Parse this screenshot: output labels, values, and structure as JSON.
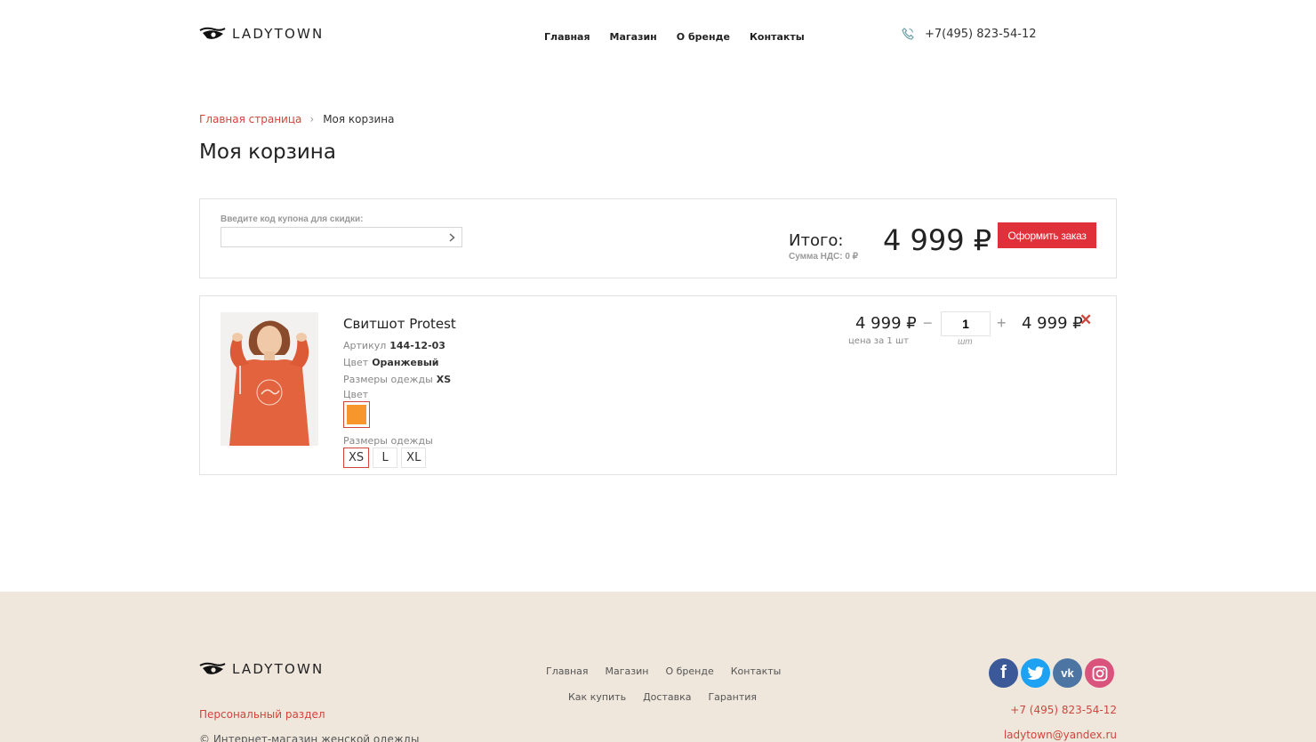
{
  "brand": {
    "name": "LADYTOWN"
  },
  "header": {
    "nav": [
      "Главная",
      "Магазин",
      "О бренде",
      "Контакты"
    ],
    "phone": "+7(495) 823-54-12"
  },
  "breadcrumb": {
    "home": "Главная страница",
    "separator": "›",
    "current": "Моя корзина"
  },
  "page_title": "Моя корзина",
  "summary": {
    "coupon_label": "Введите код купона для скидки:",
    "coupon_value": "",
    "total_label": "Итого:",
    "vat": "Сумма НДС: 0 ₽",
    "total_value": "4 999 ₽",
    "order_button": "Оформить заказ"
  },
  "cart_item": {
    "name": "Свитшот Protest",
    "article_label": "Артикул",
    "article": "144-12-03",
    "color_label": "Цвет",
    "color": "Оранжевый",
    "size_label": "Размеры одежды",
    "size": "XS",
    "color_heading": "Цвет",
    "swatch_color": "#f7962b",
    "sizes_heading": "Размеры одежды",
    "sizes": [
      "XS",
      "L",
      "XL"
    ],
    "selected_size": "XS",
    "unit_price": "4 999 ₽",
    "unit_note": "цена за 1 шт",
    "minus": "−",
    "quantity": "1",
    "plus": "+",
    "qty_unit": "шт",
    "line_total": "4 999 ₽",
    "remove": "✕"
  },
  "footer": {
    "nav_row1": [
      "Главная",
      "Магазин",
      "О бренде",
      "Контакты"
    ],
    "nav_row2": [
      "Как купить",
      "Доставка",
      "Гарантия"
    ],
    "personal": "Персональный раздел",
    "copyright": "© Интернет-магазин женской одежды",
    "socials": [
      {
        "icon": "facebook-icon",
        "glyph": "f"
      },
      {
        "icon": "twitter-icon",
        "glyph": ""
      },
      {
        "icon": "vk-icon",
        "glyph": "vk"
      },
      {
        "icon": "instagram-icon",
        "glyph": ""
      }
    ],
    "phone": "+7 (495) 823-54-12",
    "email": "ladytown@yandex.ru"
  },
  "colors": {
    "accent": "#d0453c",
    "button": "#e0303a",
    "footer_bg": "#efe7dc"
  }
}
